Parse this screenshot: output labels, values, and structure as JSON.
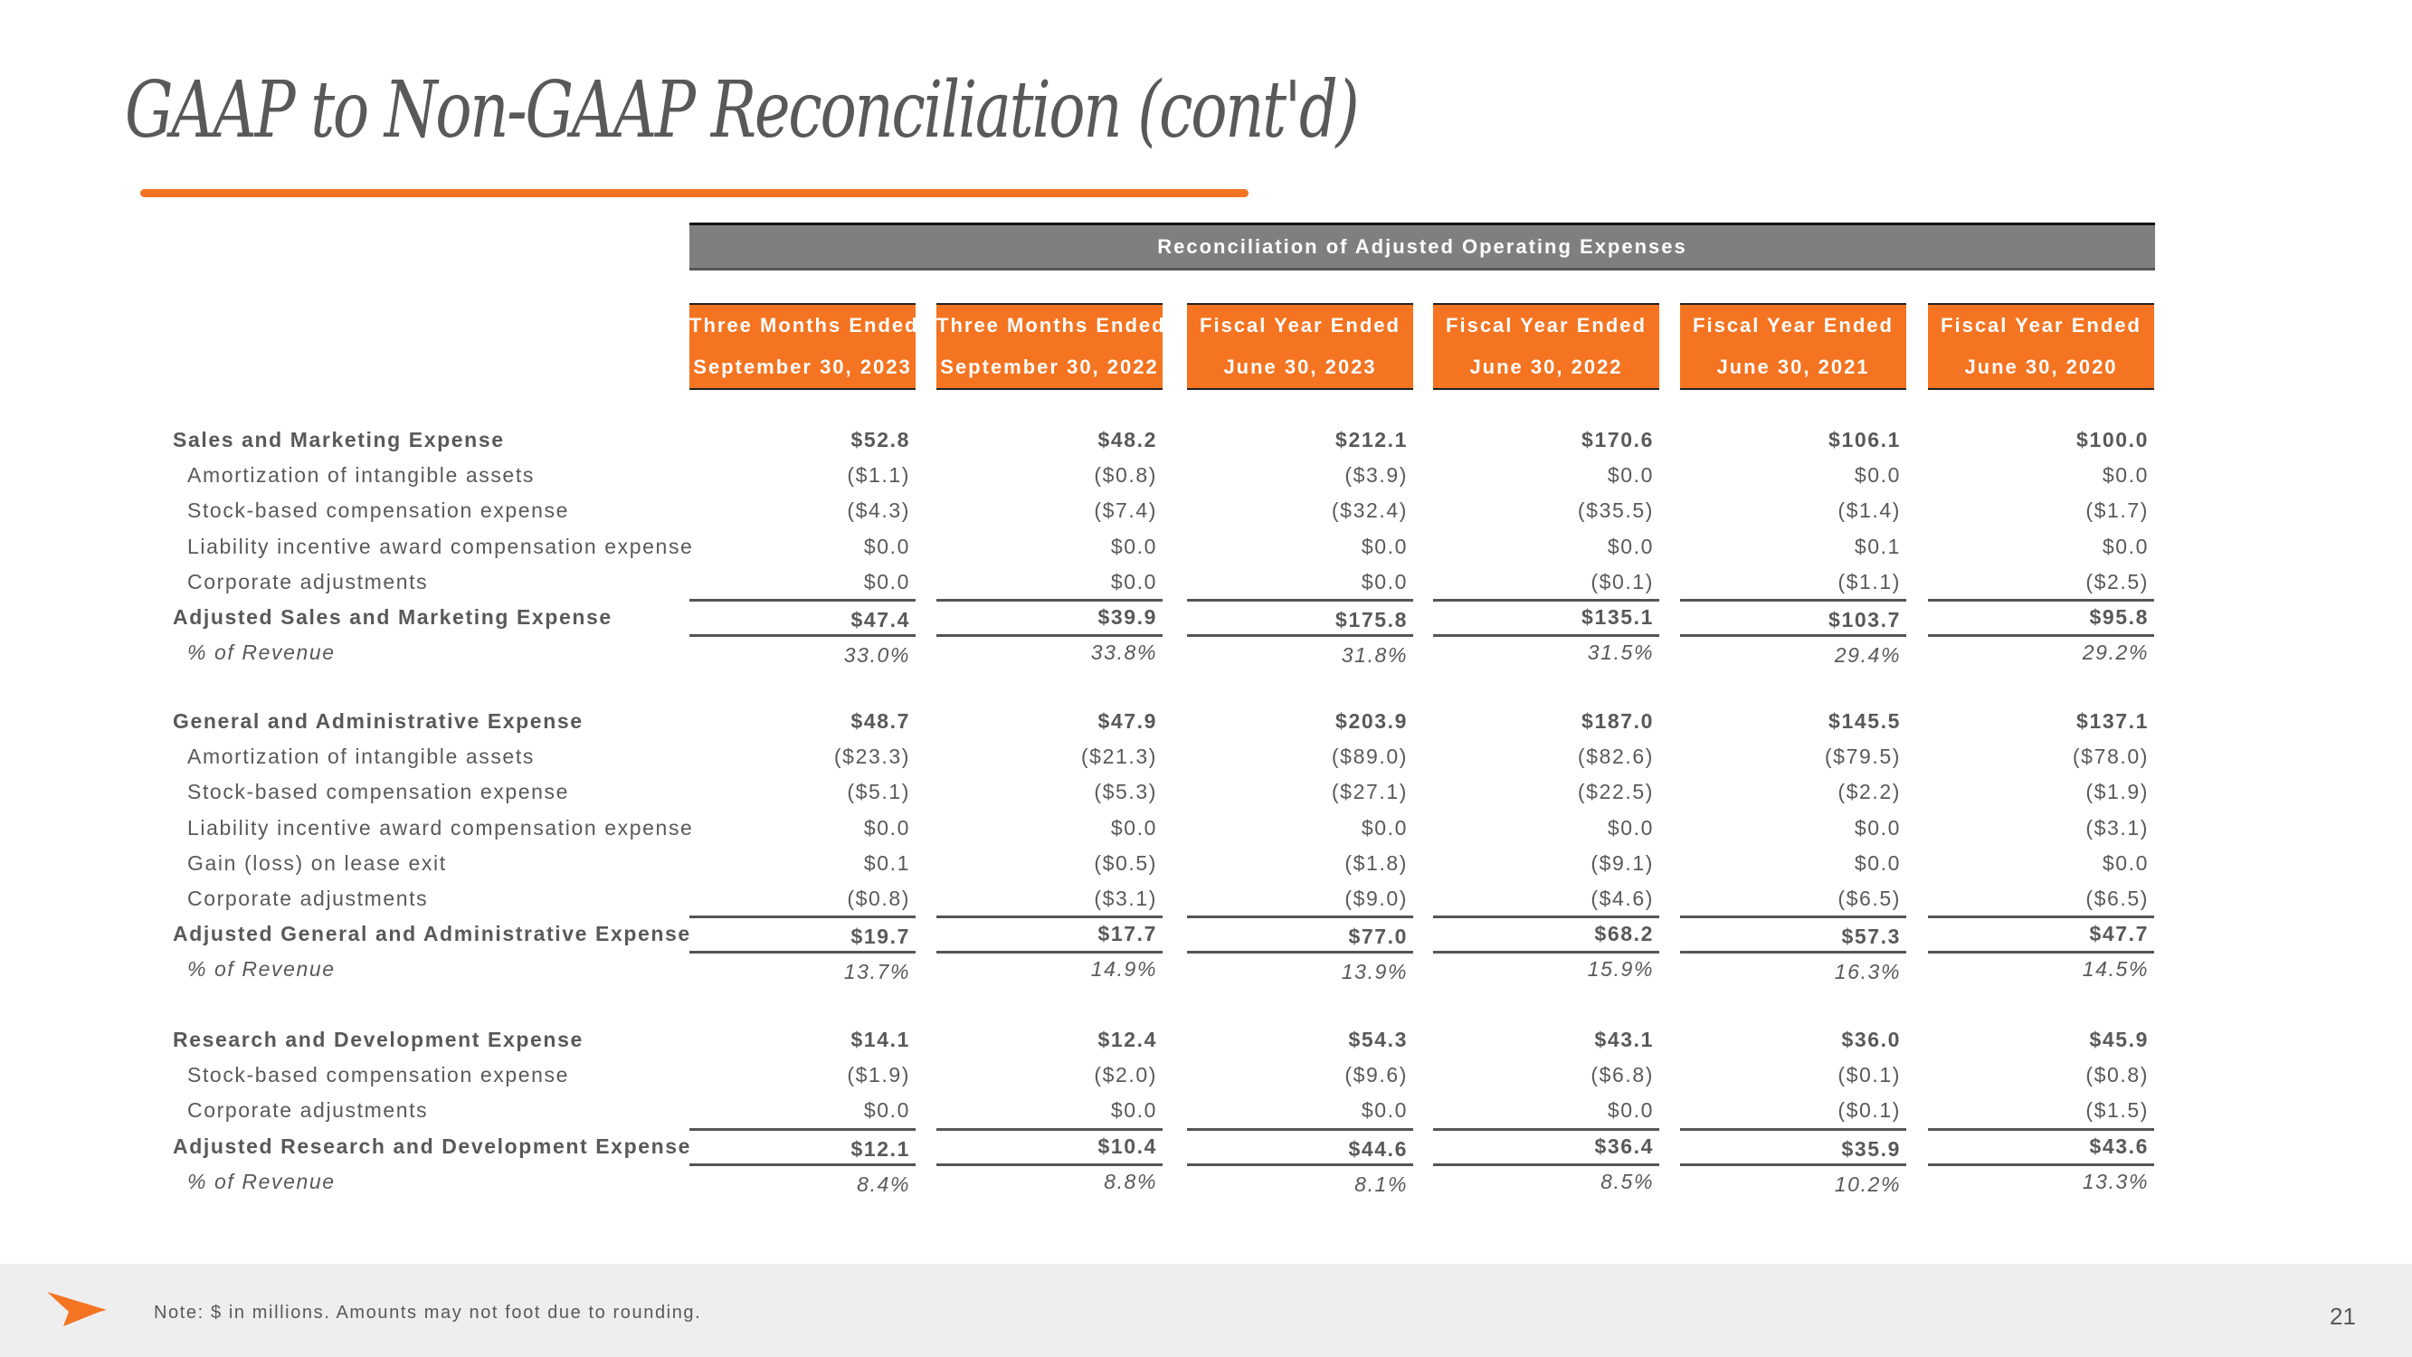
{
  "slide": {
    "title": "GAAP to Non-GAAP Reconciliation (cont'd)",
    "banner": "Reconciliation of Adjusted Operating Expenses",
    "columns": [
      {
        "line1": "Three Months Ended",
        "line2": "September 30, 2023"
      },
      {
        "line1": "Three Months Ended",
        "line2": "September 30, 2022"
      },
      {
        "line1": "Fiscal Year Ended",
        "line2": "June 30, 2023"
      },
      {
        "line1": "Fiscal Year Ended",
        "line2": "June 30, 2022"
      },
      {
        "line1": "Fiscal Year Ended",
        "line2": "June 30, 2021"
      },
      {
        "line1": "Fiscal Year Ended",
        "line2": "June 30, 2020"
      }
    ],
    "sections": [
      {
        "rows": [
          {
            "label": "Sales and Marketing Expense",
            "type": "header",
            "values": [
              "$52.8",
              "$48.2",
              "$212.1",
              "$170.6",
              "$106.1",
              "$100.0"
            ]
          },
          {
            "label": "Amortization of intangible assets",
            "type": "sub",
            "values": [
              "($1.1)",
              "($0.8)",
              "($3.9)",
              "$0.0",
              "$0.0",
              "$0.0"
            ]
          },
          {
            "label": "Stock-based compensation expense",
            "type": "sub",
            "values": [
              "($4.3)",
              "($7.4)",
              "($32.4)",
              "($35.5)",
              "($1.4)",
              "($1.7)"
            ]
          },
          {
            "label": "Liability incentive award compensation expense",
            "type": "sub",
            "values": [
              "$0.0",
              "$0.0",
              "$0.0",
              "$0.0",
              "$0.1",
              "$0.0"
            ]
          },
          {
            "label": "Corporate adjustments",
            "type": "sub",
            "values": [
              "$0.0",
              "$0.0",
              "$0.0",
              "($0.1)",
              "($1.1)",
              "($2.5)"
            ]
          },
          {
            "label": "Adjusted Sales and Marketing Expense",
            "type": "total",
            "values": [
              "$47.4",
              "$39.9",
              "$175.8",
              "$135.1",
              "$103.7",
              "$95.8"
            ]
          },
          {
            "label": "% of Revenue",
            "type": "pct",
            "values": [
              "33.0%",
              "33.8%",
              "31.8%",
              "31.5%",
              "29.4%",
              "29.2%"
            ]
          }
        ]
      },
      {
        "rows": [
          {
            "label": "General and Administrative Expense",
            "type": "header",
            "values": [
              "$48.7",
              "$47.9",
              "$203.9",
              "$187.0",
              "$145.5",
              "$137.1"
            ]
          },
          {
            "label": "Amortization of intangible assets",
            "type": "sub",
            "values": [
              "($23.3)",
              "($21.3)",
              "($89.0)",
              "($82.6)",
              "($79.5)",
              "($78.0)"
            ]
          },
          {
            "label": "Stock-based compensation expense",
            "type": "sub",
            "values": [
              "($5.1)",
              "($5.3)",
              "($27.1)",
              "($22.5)",
              "($2.2)",
              "($1.9)"
            ]
          },
          {
            "label": "Liability incentive award compensation expense",
            "type": "sub",
            "values": [
              "$0.0",
              "$0.0",
              "$0.0",
              "$0.0",
              "$0.0",
              "($3.1)"
            ]
          },
          {
            "label": "Gain (loss) on lease exit",
            "type": "sub",
            "values": [
              "$0.1",
              "($0.5)",
              "($1.8)",
              "($9.1)",
              "$0.0",
              "$0.0"
            ]
          },
          {
            "label": "Corporate adjustments",
            "type": "sub",
            "values": [
              "($0.8)",
              "($3.1)",
              "($9.0)",
              "($4.6)",
              "($6.5)",
              "($6.5)"
            ]
          },
          {
            "label": "Adjusted General and Administrative Expense",
            "type": "total",
            "values": [
              "$19.7",
              "$17.7",
              "$77.0",
              "$68.2",
              "$57.3",
              "$47.7"
            ]
          },
          {
            "label": "% of Revenue",
            "type": "pct",
            "values": [
              "13.7%",
              "14.9%",
              "13.9%",
              "15.9%",
              "16.3%",
              "14.5%"
            ]
          }
        ]
      },
      {
        "rows": [
          {
            "label": "Research and Development Expense",
            "type": "header",
            "values": [
              "$14.1",
              "$12.4",
              "$54.3",
              "$43.1",
              "$36.0",
              "$45.9"
            ]
          },
          {
            "label": "Stock-based compensation expense",
            "type": "sub",
            "values": [
              "($1.9)",
              "($2.0)",
              "($9.6)",
              "($6.8)",
              "($0.1)",
              "($0.8)"
            ]
          },
          {
            "label": "Corporate adjustments",
            "type": "sub",
            "values": [
              "$0.0",
              "$0.0",
              "$0.0",
              "$0.0",
              "($0.1)",
              "($1.5)"
            ]
          },
          {
            "label": "Adjusted Research and Development Expense",
            "type": "total",
            "values": [
              "$12.1",
              "$10.4",
              "$44.6",
              "$36.4",
              "$35.9",
              "$43.6"
            ]
          },
          {
            "label": "% of Revenue",
            "type": "pct",
            "values": [
              "8.4%",
              "8.8%",
              "8.1%",
              "8.5%",
              "10.2%",
              "13.3%"
            ]
          }
        ]
      }
    ],
    "footer": {
      "note": "Note: $ in millions. Amounts may not foot due to rounding.",
      "page_number": "21",
      "logo_icon": "orange-arrow-logo",
      "accent_color": "#f47421"
    }
  }
}
